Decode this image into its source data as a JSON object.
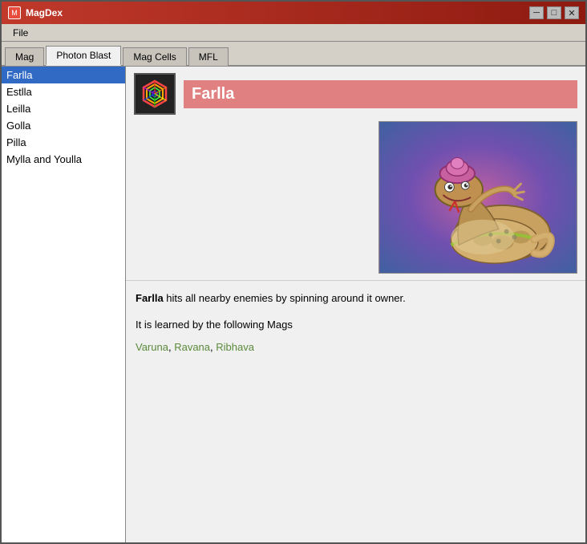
{
  "window": {
    "title": "MagDex",
    "title_icon": "M"
  },
  "title_controls": {
    "minimize": "─",
    "maximize": "□",
    "close": "✕"
  },
  "menu": {
    "file_label": "File"
  },
  "tabs": [
    {
      "id": "mag",
      "label": "Mag",
      "active": false
    },
    {
      "id": "photon-blast",
      "label": "Photon Blast",
      "active": true
    },
    {
      "id": "mag-cells",
      "label": "Mag Cells",
      "active": false
    },
    {
      "id": "mfl",
      "label": "MFL",
      "active": false
    }
  ],
  "sidebar": {
    "items": [
      {
        "id": "farlla",
        "label": "Farlla",
        "selected": true
      },
      {
        "id": "estlla",
        "label": "Estlla",
        "selected": false
      },
      {
        "id": "leilla",
        "label": "Leilla",
        "selected": false
      },
      {
        "id": "golla",
        "label": "Golla",
        "selected": false
      },
      {
        "id": "pilla",
        "label": "Pilla",
        "selected": false
      },
      {
        "id": "mylla-youlla",
        "label": "Mylla and Youlla",
        "selected": false
      }
    ]
  },
  "detail": {
    "name": "Farlla",
    "name_bar_color": "#d97070",
    "description_bold": "Farlla",
    "description_text": " hits all nearby enemies by spinning around it owner.",
    "mags_intro": "It is learned by the following Mags",
    "mags": [
      {
        "name": "Varuna",
        "color": "#5a8a3c"
      },
      {
        "name": "Ravana",
        "color": "#5a8a3c"
      },
      {
        "name": "Ribhava",
        "color": "#5a8a3c"
      }
    ],
    "icon_alt": "photon-blast-icon"
  },
  "colors": {
    "title_bar_start": "#c0392b",
    "title_bar_end": "#8e1a10",
    "tab_active_bg": "#f0f0f0",
    "selected_item_bg": "#316ac5",
    "name_bar_bg": "#d97070",
    "mag_link_color": "#5a8a3c"
  }
}
